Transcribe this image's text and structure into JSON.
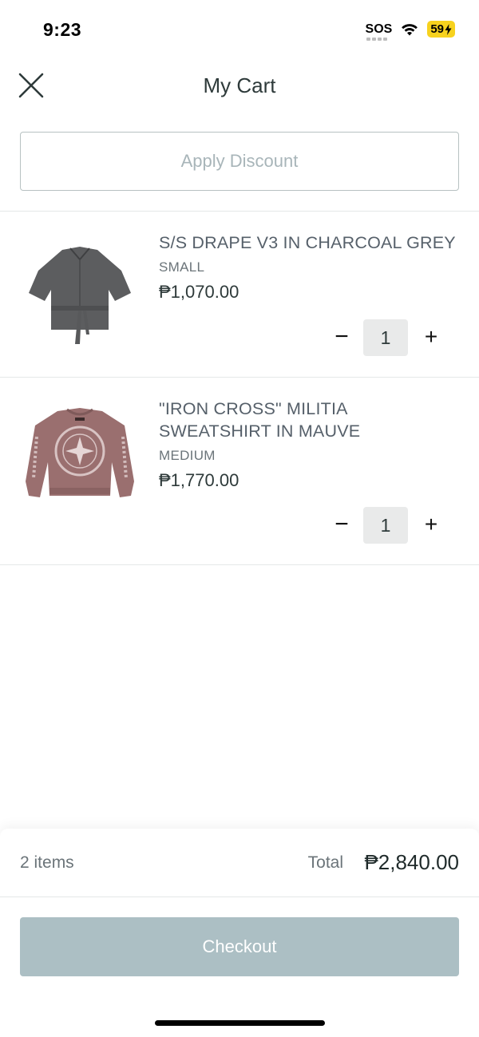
{
  "status_bar": {
    "time": "9:23",
    "carrier": "SOS",
    "battery": "59"
  },
  "header": {
    "title": "My Cart",
    "close_icon": "close-icon"
  },
  "discount": {
    "label": "Apply Discount"
  },
  "items": [
    {
      "name": "S/S DRAPE V3 IN CHARCOAL GREY",
      "variant": "SMALL",
      "price": "₱1,070.00",
      "quantity": "1",
      "thumb_color": "#5c5d5f"
    },
    {
      "name": "\"IRON CROSS\" MILITIA SWEATSHIRT IN MAUVE",
      "variant": "MEDIUM",
      "price": "₱1,770.00",
      "quantity": "1",
      "thumb_color": "#9a6f6f"
    }
  ],
  "qty_controls": {
    "minus": "−",
    "plus": "+"
  },
  "summary": {
    "items_count": "2 items",
    "total_label": "Total",
    "total_value": "₱2,840.00"
  },
  "checkout": {
    "label": "Checkout"
  },
  "colors": {
    "text_primary": "#2e3a3a",
    "checkout_bg": "#acbfc4",
    "discount_border": "#b7c1c2",
    "battery_bg": "#f7d21e"
  }
}
